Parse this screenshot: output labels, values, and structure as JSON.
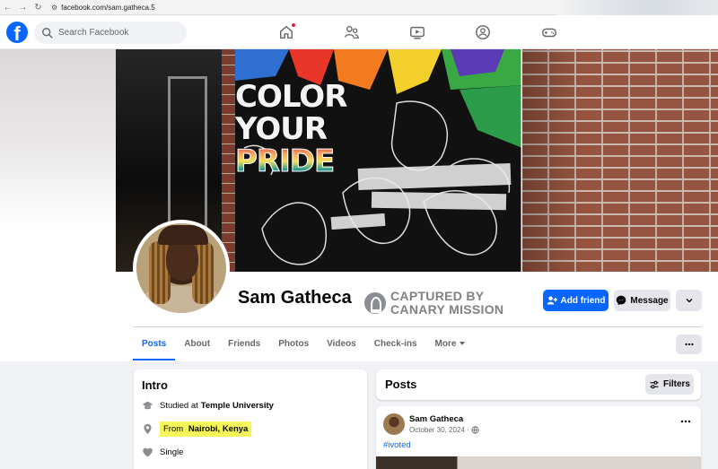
{
  "browser": {
    "url": "facebook.com/sam.gatheca.5"
  },
  "header": {
    "logo": "f",
    "search_placeholder": "Search Facebook",
    "nav_icons": [
      "home-icon",
      "friends-icon",
      "video-icon",
      "groups-icon",
      "gaming-icon"
    ]
  },
  "cover": {
    "mural_line1": "COLOR",
    "mural_line2": "YOUR",
    "mural_line3": "PRIDE"
  },
  "profile": {
    "name": "Sam Gatheca",
    "watermark_line1": "CAPTURED BY",
    "watermark_line2": "CANARY MISSION",
    "add_friend_label": "Add friend",
    "message_label": "Message"
  },
  "tabs": [
    {
      "label": "Posts",
      "active": true
    },
    {
      "label": "About"
    },
    {
      "label": "Friends"
    },
    {
      "label": "Photos"
    },
    {
      "label": "Videos"
    },
    {
      "label": "Check-ins"
    },
    {
      "label": "More"
    }
  ],
  "intro": {
    "title": "Intro",
    "studied_prefix": "Studied at",
    "studied_school": "Temple University",
    "from_prefix": "From",
    "from_place": "Nairobi, Kenya",
    "relationship": "Single"
  },
  "posts": {
    "title": "Posts",
    "filters_label": "Filters",
    "first_post": {
      "author": "Sam Gatheca",
      "date": "October 30, 2024",
      "separator": "·",
      "hashtag": "#ivoted"
    }
  },
  "colors": {
    "brand": "#0866ff",
    "highlight": "#f6f559",
    "background": "#f0f2f5"
  }
}
